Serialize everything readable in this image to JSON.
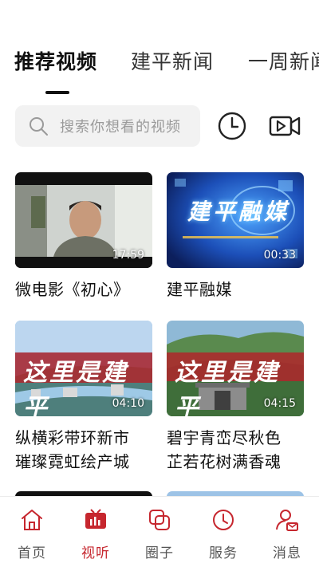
{
  "tabs": [
    {
      "label": "推荐视频",
      "active": true
    },
    {
      "label": "建平新闻",
      "active": false
    },
    {
      "label": "一周新闻",
      "active": false
    }
  ],
  "search": {
    "placeholder": "搜索你想看的视频",
    "icon": "search-icon"
  },
  "toolbar": {
    "history_icon": "clock-icon",
    "video_icon": "video-camera-icon"
  },
  "videos": [
    {
      "title": "微电影《初心》",
      "duration": "17:59"
    },
    {
      "title": "建平融媒",
      "duration": "00:33",
      "thumb_text": "建平融媒"
    },
    {
      "title": "纵横彩带环新市\n璀璨霓虹绘产城",
      "duration": "04:10",
      "thumb_text": "这里是建平"
    },
    {
      "title": "碧宇青峦尽秋色\n芷若花树满香魂",
      "duration": "04:15",
      "thumb_text": "这里是建平"
    }
  ],
  "bottom_nav": [
    {
      "label": "首页",
      "icon": "home-icon",
      "active": false
    },
    {
      "label": "视听",
      "icon": "tv-icon",
      "active": true
    },
    {
      "label": "圈子",
      "icon": "circle-chat-icon",
      "active": false
    },
    {
      "label": "服务",
      "icon": "clock-service-icon",
      "active": false
    },
    {
      "label": "消息",
      "icon": "user-message-icon",
      "active": false
    }
  ],
  "colors": {
    "accent": "#c6262e",
    "search_bg": "#f2f2f2"
  }
}
